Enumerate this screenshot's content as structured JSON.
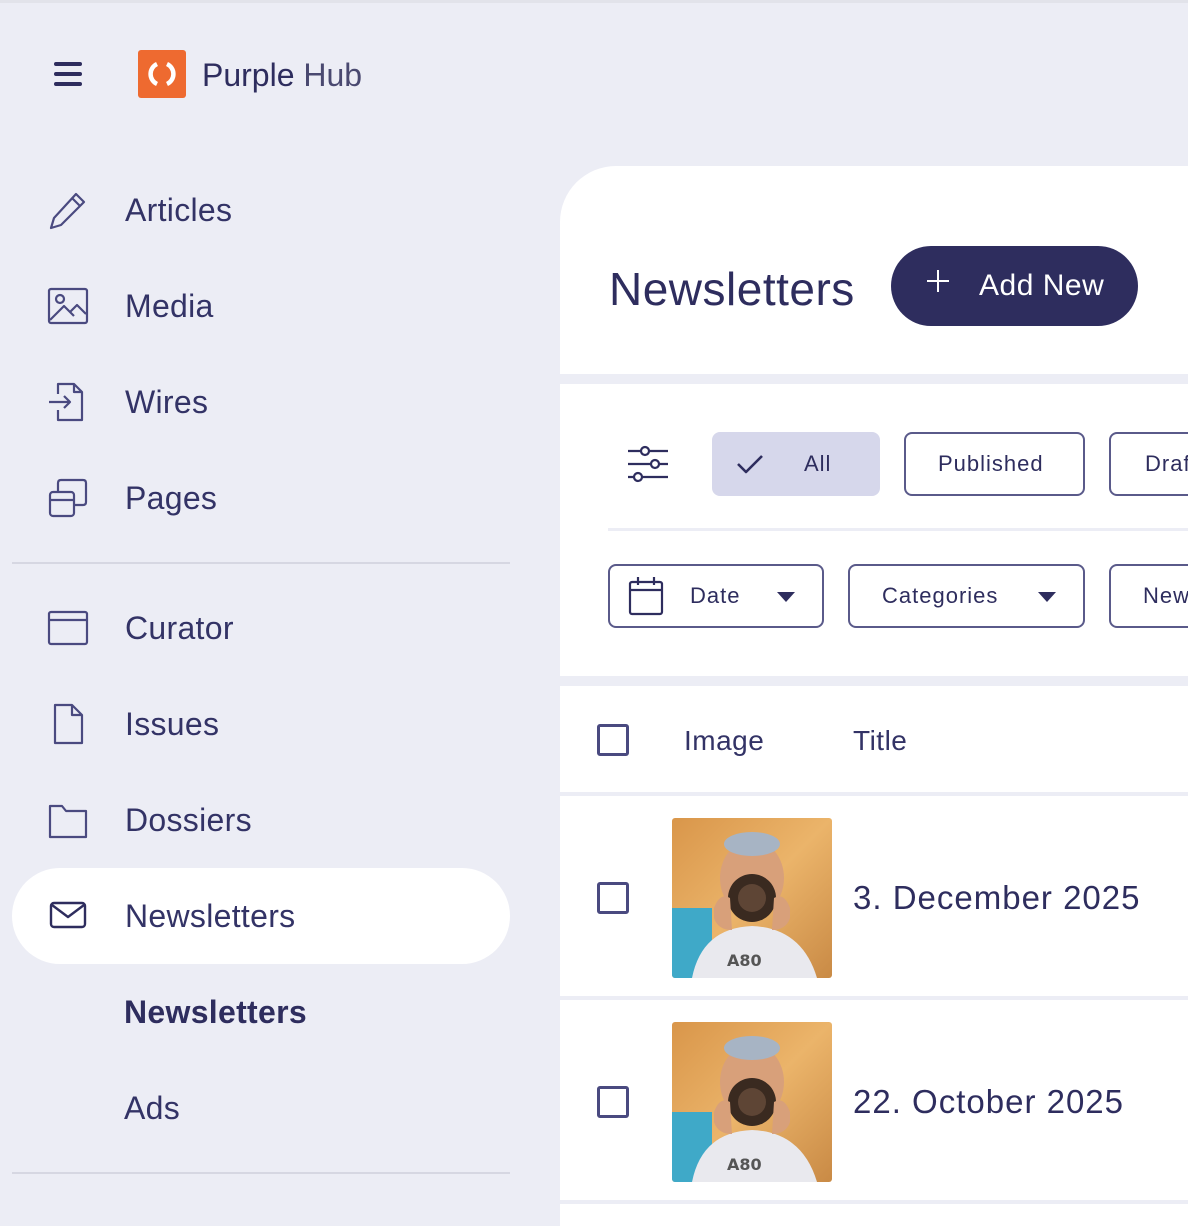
{
  "app": {
    "brand_primary": "Purple",
    "brand_secondary": "Hub",
    "logo_icon": "purple-hub-logo-icon",
    "accent_color": "#EE6A30",
    "primary_color": "#2E2D5E"
  },
  "sidebar": {
    "menu_icon": "hamburger-menu-icon",
    "items": [
      {
        "label": "Articles",
        "icon": "pencil-icon"
      },
      {
        "label": "Media",
        "icon": "image-icon"
      },
      {
        "label": "Wires",
        "icon": "file-import-icon"
      },
      {
        "label": "Pages",
        "icon": "pages-stack-icon"
      },
      {
        "label": "Curator",
        "icon": "browser-window-icon"
      },
      {
        "label": "Issues",
        "icon": "document-icon"
      },
      {
        "label": "Dossiers",
        "icon": "folder-icon"
      },
      {
        "label": "Newsletters",
        "icon": "envelope-icon",
        "active": true
      }
    ],
    "sub_items": [
      {
        "label": "Newsletters",
        "active": true
      },
      {
        "label": "Ads"
      }
    ]
  },
  "main": {
    "title": "Newsletters",
    "add_button_label": "Add New",
    "status_filters": [
      {
        "label": "All",
        "selected": true
      },
      {
        "label": "Published"
      },
      {
        "label": "Draf"
      }
    ],
    "dropdown_filters": [
      {
        "label": "Date",
        "icon": "calendar-icon"
      },
      {
        "label": "Categories"
      },
      {
        "label": "New"
      }
    ],
    "table": {
      "columns": [
        "Image",
        "Title"
      ],
      "rows": [
        {
          "title": "3. December 2025",
          "image": "photographer-thumbnail"
        },
        {
          "title": "22. October 2025",
          "image": "photographer-thumbnail"
        }
      ]
    }
  }
}
